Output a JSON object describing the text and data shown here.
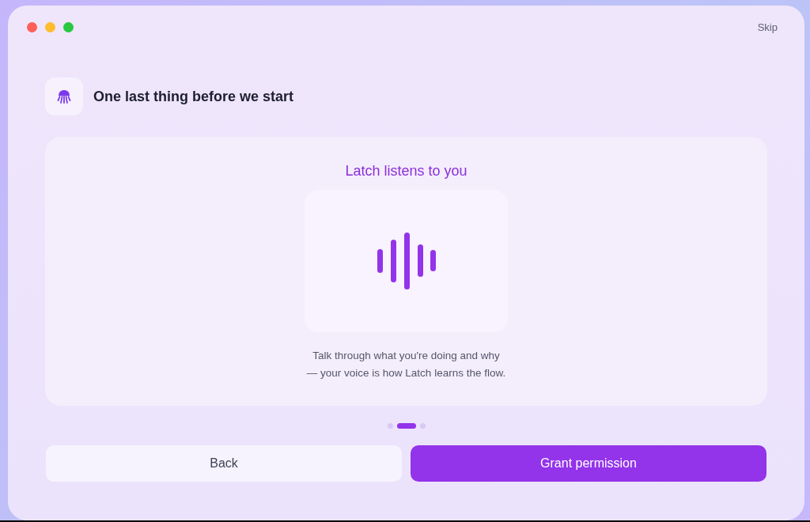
{
  "window": {
    "skip_label": "Skip"
  },
  "header": {
    "title": "One last thing before we start"
  },
  "card": {
    "title": "Latch listens to you",
    "description_lines": [
      "Talk through what you're doing and why",
      "— your voice is how Latch learns the flow."
    ]
  },
  "pagination": [
    {
      "selected": false
    },
    {
      "selected": true
    },
    {
      "selected": false
    }
  ],
  "buttons": [
    {
      "label": "Back",
      "kind": "secondary"
    },
    {
      "label": "Grant permission",
      "kind": "primary"
    }
  ]
}
